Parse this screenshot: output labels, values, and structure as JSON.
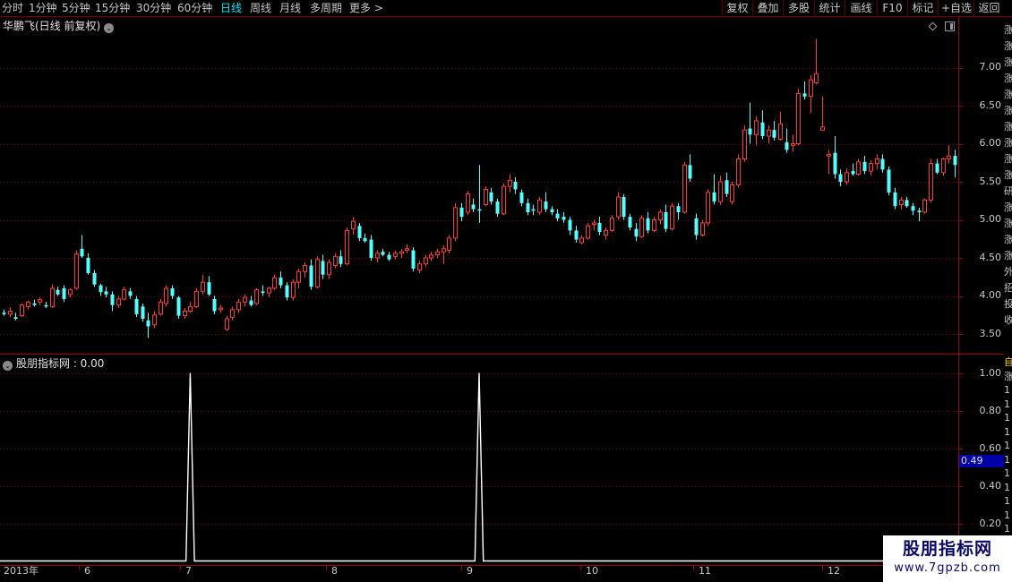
{
  "toolbar": {
    "periods": [
      "分时",
      "1分钟",
      "5分钟",
      "15分钟",
      "30分钟",
      "60分钟",
      "日线",
      "周线",
      "月线",
      "多周期",
      "更多 >"
    ],
    "active_period": "日线",
    "buttons": [
      "复权",
      "叠加",
      "多股",
      "统计",
      "画线",
      "F10",
      "标记",
      "+自选",
      "返回"
    ]
  },
  "price_panel": {
    "title": "华鹏飞(日线 前复权)",
    "y_ticks": [
      "7.00",
      "6.50",
      "6.00",
      "5.50",
      "5.00",
      "4.50",
      "4.00",
      "3.50"
    ]
  },
  "indicator_panel": {
    "title": "股朋指标网 : 0.00",
    "y_ticks": [
      "1.00",
      "0.80",
      "0.60",
      "0.40",
      "0.20"
    ],
    "cursor_value": "0.49"
  },
  "x_axis": {
    "labels": [
      "2013年",
      "6",
      "7",
      "8",
      "9",
      "10",
      "11",
      "12"
    ]
  },
  "right_strip": {
    "price_chars": [
      "涨",
      "涨",
      "涨",
      "涨",
      "涨",
      "涨",
      "涨",
      "涨",
      "涨",
      "涨",
      "研",
      "涨",
      "涨",
      "涨",
      "涨",
      "外",
      "招",
      "投",
      "收"
    ],
    "indicator_chars": [
      "自",
      "涨",
      "1",
      "1",
      "1",
      "1",
      "1",
      "1",
      "1",
      "1",
      "1",
      "1",
      "1",
      "1",
      "1",
      "1"
    ]
  },
  "watermark": {
    "title": "股朋指标网",
    "url": "www.7gpzb.com"
  },
  "colors": {
    "up": "#ff3c3c",
    "down": "#54ffff",
    "grid": "#8b0000",
    "border": "#a00000",
    "indicator_line": "#ffffff",
    "active_tab": "#00e5ff",
    "cursor_bg": "#0000a8"
  },
  "chart_data": [
    {
      "type": "candlestick",
      "title": "华鹏飞(日线 前复权)",
      "ylim": [
        3.3,
        7.4
      ],
      "y_ticks": [
        3.5,
        4.0,
        4.5,
        5.0,
        5.5,
        6.0,
        6.5,
        7.0
      ],
      "x_month_labels": [
        "2013年",
        "6",
        "7",
        "8",
        "9",
        "10",
        "11",
        "12"
      ],
      "candles": [
        [
          3.78,
          3.82,
          3.74,
          3.76
        ],
        [
          3.76,
          3.85,
          3.72,
          3.8
        ],
        [
          3.72,
          3.78,
          3.68,
          3.7
        ],
        [
          3.74,
          3.9,
          3.72,
          3.88
        ],
        [
          3.86,
          3.94,
          3.82,
          3.92
        ],
        [
          3.9,
          3.95,
          3.86,
          3.88
        ],
        [
          3.92,
          3.98,
          3.88,
          3.95
        ],
        [
          3.88,
          3.92,
          3.84,
          3.86
        ],
        [
          3.86,
          4.15,
          3.84,
          4.1
        ],
        [
          4.08,
          4.12,
          4.0,
          4.02
        ],
        [
          4.1,
          4.14,
          3.92,
          3.96
        ],
        [
          4.02,
          4.1,
          3.98,
          4.08
        ],
        [
          4.1,
          4.6,
          4.08,
          4.55
        ],
        [
          4.62,
          4.8,
          4.5,
          4.52
        ],
        [
          4.5,
          4.56,
          4.28,
          4.3
        ],
        [
          4.3,
          4.34,
          4.12,
          4.15
        ],
        [
          4.14,
          4.16,
          4.0,
          4.05
        ],
        [
          4.06,
          4.12,
          3.98,
          4.02
        ],
        [
          4.02,
          4.06,
          3.8,
          3.88
        ],
        [
          3.88,
          4.0,
          3.84,
          3.96
        ],
        [
          3.96,
          4.12,
          3.94,
          4.08
        ],
        [
          4.06,
          4.1,
          3.96,
          4.0
        ],
        [
          3.96,
          4.0,
          3.72,
          3.76
        ],
        [
          3.86,
          3.9,
          3.66,
          3.7
        ],
        [
          3.68,
          3.78,
          3.45,
          3.6
        ],
        [
          3.62,
          3.8,
          3.58,
          3.75
        ],
        [
          3.76,
          3.96,
          3.74,
          3.92
        ],
        [
          3.9,
          4.14,
          3.86,
          4.1
        ],
        [
          4.1,
          4.14,
          3.96,
          4.0
        ],
        [
          3.98,
          4.0,
          3.7,
          3.74
        ],
        [
          3.74,
          3.84,
          3.7,
          3.8
        ],
        [
          3.8,
          3.92,
          3.78,
          3.86
        ],
        [
          3.86,
          4.1,
          3.84,
          4.06
        ],
        [
          4.06,
          4.28,
          4.02,
          4.18
        ],
        [
          4.18,
          4.26,
          4.0,
          4.02
        ],
        [
          3.96,
          4.0,
          3.76,
          3.8
        ],
        [
          3.82,
          3.88,
          3.78,
          3.84
        ],
        [
          3.56,
          3.74,
          3.54,
          3.7
        ],
        [
          3.72,
          3.86,
          3.68,
          3.82
        ],
        [
          3.82,
          3.96,
          3.78,
          3.92
        ],
        [
          3.92,
          4.02,
          3.86,
          3.98
        ],
        [
          3.94,
          4.0,
          3.86,
          3.88
        ],
        [
          3.9,
          4.1,
          3.88,
          4.08
        ],
        [
          4.06,
          4.14,
          4.0,
          4.04
        ],
        [
          4.04,
          4.12,
          3.98,
          4.1
        ],
        [
          4.1,
          4.28,
          4.08,
          4.24
        ],
        [
          4.24,
          4.32,
          4.1,
          4.14
        ],
        [
          4.14,
          4.18,
          3.94,
          3.98
        ],
        [
          3.98,
          4.22,
          3.94,
          4.18
        ],
        [
          4.18,
          4.36,
          4.1,
          4.32
        ],
        [
          4.32,
          4.44,
          4.24,
          4.4
        ],
        [
          4.4,
          4.48,
          4.08,
          4.12
        ],
        [
          4.12,
          4.52,
          4.1,
          4.48
        ],
        [
          4.46,
          4.54,
          4.22,
          4.28
        ],
        [
          4.28,
          4.48,
          4.22,
          4.44
        ],
        [
          4.4,
          4.56,
          4.36,
          4.52
        ],
        [
          4.52,
          4.6,
          4.38,
          4.42
        ],
        [
          4.42,
          4.9,
          4.4,
          4.86
        ],
        [
          4.88,
          5.04,
          4.8,
          4.98
        ],
        [
          4.92,
          4.96,
          4.72,
          4.76
        ],
        [
          4.76,
          4.82,
          4.7,
          4.72
        ],
        [
          4.74,
          4.8,
          4.46,
          4.5
        ],
        [
          4.5,
          4.6,
          4.44,
          4.56
        ],
        [
          4.58,
          4.62,
          4.52,
          4.54
        ],
        [
          4.54,
          4.58,
          4.46,
          4.48
        ],
        [
          4.52,
          4.6,
          4.48,
          4.56
        ],
        [
          4.56,
          4.62,
          4.5,
          4.58
        ],
        [
          4.6,
          4.68,
          4.56,
          4.62
        ],
        [
          4.6,
          4.64,
          4.32,
          4.36
        ],
        [
          4.34,
          4.46,
          4.3,
          4.42
        ],
        [
          4.42,
          4.54,
          4.38,
          4.5
        ],
        [
          4.5,
          4.58,
          4.46,
          4.54
        ],
        [
          4.54,
          4.62,
          4.5,
          4.58
        ],
        [
          4.58,
          4.66,
          4.42,
          4.62
        ],
        [
          4.6,
          4.8,
          4.56,
          4.76
        ],
        [
          4.76,
          5.22,
          4.72,
          5.16
        ],
        [
          5.16,
          5.22,
          4.98,
          5.04
        ],
        [
          5.1,
          5.38,
          5.06,
          5.34
        ],
        [
          5.2,
          5.28,
          5.1,
          5.14
        ],
        [
          5.14,
          5.72,
          4.96,
          5.12
        ],
        [
          5.2,
          5.44,
          5.18,
          5.4
        ],
        [
          5.36,
          5.42,
          5.2,
          5.24
        ],
        [
          5.24,
          5.28,
          5.04,
          5.08
        ],
        [
          5.08,
          5.48,
          5.06,
          5.44
        ],
        [
          5.44,
          5.6,
          5.36,
          5.52
        ],
        [
          5.5,
          5.56,
          5.34,
          5.4
        ],
        [
          5.36,
          5.4,
          5.18,
          5.22
        ],
        [
          5.22,
          5.28,
          5.06,
          5.1
        ],
        [
          5.14,
          5.2,
          5.06,
          5.12
        ],
        [
          5.1,
          5.3,
          5.06,
          5.26
        ],
        [
          5.24,
          5.36,
          5.1,
          5.14
        ],
        [
          5.14,
          5.18,
          5.06,
          5.1
        ],
        [
          5.08,
          5.14,
          4.98,
          5.02
        ],
        [
          5.04,
          5.1,
          4.96,
          5.0
        ],
        [
          5.0,
          5.04,
          4.8,
          4.86
        ],
        [
          4.86,
          4.92,
          4.7,
          4.74
        ],
        [
          4.7,
          4.8,
          4.68,
          4.76
        ],
        [
          4.76,
          4.96,
          4.74,
          4.92
        ],
        [
          4.94,
          5.0,
          4.86,
          4.96
        ],
        [
          4.96,
          5.04,
          4.8,
          4.84
        ],
        [
          4.8,
          4.9,
          4.74,
          4.86
        ],
        [
          4.86,
          5.06,
          4.84,
          5.02
        ],
        [
          5.04,
          5.36,
          5.0,
          5.3
        ],
        [
          5.3,
          5.34,
          5.0,
          5.04
        ],
        [
          5.04,
          5.08,
          4.86,
          4.9
        ],
        [
          4.88,
          4.96,
          4.72,
          4.78
        ],
        [
          4.78,
          5.06,
          4.76,
          5.02
        ],
        [
          5.02,
          5.1,
          4.82,
          4.86
        ],
        [
          4.86,
          5.04,
          4.84,
          5.0
        ],
        [
          5.0,
          5.14,
          4.94,
          5.1
        ],
        [
          5.1,
          5.2,
          4.84,
          4.88
        ],
        [
          4.88,
          5.22,
          4.86,
          5.18
        ],
        [
          5.18,
          5.22,
          5.0,
          5.1
        ],
        [
          5.1,
          5.76,
          5.08,
          5.72
        ],
        [
          5.72,
          5.86,
          5.5,
          5.54
        ],
        [
          5.02,
          5.08,
          4.74,
          4.8
        ],
        [
          4.8,
          5.0,
          4.78,
          4.96
        ],
        [
          4.96,
          5.4,
          4.92,
          5.36
        ],
        [
          5.36,
          5.6,
          5.2,
          5.24
        ],
        [
          5.24,
          5.58,
          5.2,
          5.5
        ],
        [
          5.52,
          5.62,
          5.3,
          5.34
        ],
        [
          5.24,
          5.5,
          5.2,
          5.46
        ],
        [
          5.46,
          5.86,
          5.42,
          5.8
        ],
        [
          5.8,
          6.24,
          5.76,
          6.18
        ],
        [
          6.2,
          6.54,
          6.0,
          6.12
        ],
        [
          6.12,
          6.36,
          5.98,
          6.3
        ],
        [
          6.28,
          6.44,
          6.06,
          6.1
        ],
        [
          6.1,
          6.24,
          6.0,
          6.18
        ],
        [
          6.18,
          6.3,
          6.04,
          6.08
        ],
        [
          6.06,
          6.42,
          6.04,
          6.26
        ],
        [
          6.02,
          6.2,
          5.88,
          5.92
        ],
        [
          5.98,
          6.12,
          5.9,
          6.0
        ],
        [
          6.0,
          6.72,
          5.98,
          6.66
        ],
        [
          6.66,
          6.82,
          6.58,
          6.62
        ],
        [
          6.62,
          6.9,
          6.4,
          6.84
        ],
        [
          6.8,
          7.38,
          6.78,
          6.92
        ],
        [
          6.18,
          6.62,
          6.22,
          6.22
        ],
        [
          5.84,
          5.92,
          5.6,
          5.86
        ],
        [
          5.88,
          6.1,
          5.54,
          5.6
        ],
        [
          5.6,
          5.66,
          5.44,
          5.5
        ],
        [
          5.5,
          5.68,
          5.46,
          5.62
        ],
        [
          5.64,
          5.74,
          5.58,
          5.6
        ],
        [
          5.6,
          5.8,
          5.58,
          5.76
        ],
        [
          5.76,
          5.84,
          5.6,
          5.64
        ],
        [
          5.64,
          5.78,
          5.58,
          5.74
        ],
        [
          5.74,
          5.86,
          5.66,
          5.8
        ],
        [
          5.8,
          5.86,
          5.62,
          5.66
        ],
        [
          5.66,
          5.7,
          5.32,
          5.36
        ],
        [
          5.36,
          5.42,
          5.14,
          5.18
        ],
        [
          5.2,
          5.3,
          5.14,
          5.26
        ],
        [
          5.26,
          5.3,
          5.16,
          5.18
        ],
        [
          5.18,
          5.22,
          5.06,
          5.12
        ],
        [
          5.12,
          5.16,
          4.98,
          5.1
        ],
        [
          5.1,
          5.28,
          5.08,
          5.26
        ],
        [
          5.26,
          5.8,
          5.22,
          5.74
        ],
        [
          5.74,
          5.8,
          5.6,
          5.62
        ],
        [
          5.62,
          5.82,
          5.58,
          5.8
        ],
        [
          5.8,
          5.98,
          5.74,
          5.84
        ],
        [
          5.84,
          5.92,
          5.56,
          5.72
        ]
      ]
    },
    {
      "type": "line",
      "title": "股朋指标网 : 0.00",
      "ylim": [
        0,
        1.05
      ],
      "y_ticks": [
        0.2,
        0.4,
        0.6,
        0.8,
        1.0
      ],
      "baseline": 0,
      "spikes": [
        {
          "bar_index": 31,
          "value": 1.0
        },
        {
          "bar_index": 79,
          "value": 1.0
        }
      ]
    }
  ]
}
